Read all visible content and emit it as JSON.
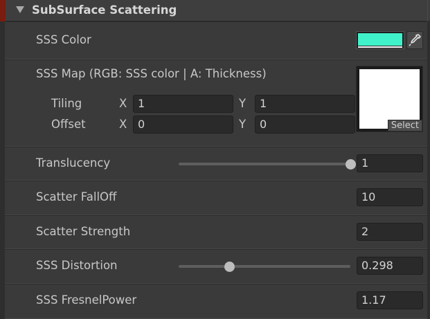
{
  "section": {
    "title": "SubSurface Scattering",
    "accent_color": "#7a1c10"
  },
  "sss_color": {
    "label": "SSS Color",
    "color": "#3ff2c9"
  },
  "sss_map": {
    "label": "SSS Map (RGB: SSS color | A: Thickness)",
    "tiling_label": "Tiling",
    "offset_label": "Offset",
    "x_label": "X",
    "y_label": "Y",
    "tiling_x": "1",
    "tiling_y": "1",
    "offset_x": "0",
    "offset_y": "0",
    "select_label": "Select"
  },
  "translucency": {
    "label": "Translucency",
    "value": "1",
    "slider_fraction": 1.0
  },
  "scatter_falloff": {
    "label": "Scatter FallOff",
    "value": "10"
  },
  "scatter_strength": {
    "label": "Scatter Strength",
    "value": "2"
  },
  "sss_distortion": {
    "label": "SSS Distortion",
    "value": "0.298",
    "slider_fraction": 0.298
  },
  "sss_fresnel_power": {
    "label": "SSS FresnelPower",
    "value": "1.17"
  }
}
